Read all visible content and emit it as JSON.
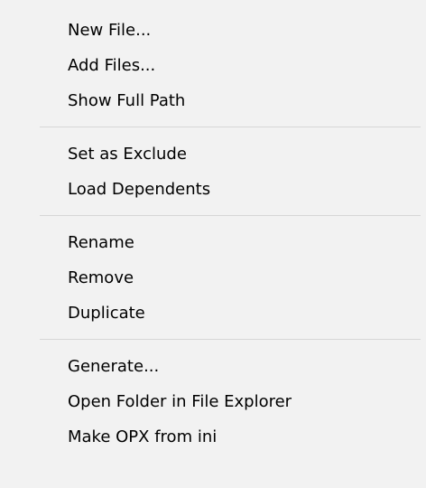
{
  "menu": {
    "groups": [
      {
        "items": [
          {
            "label": "New File..."
          },
          {
            "label": "Add Files..."
          },
          {
            "label": "Show Full Path"
          }
        ]
      },
      {
        "items": [
          {
            "label": "Set as Exclude"
          },
          {
            "label": "Load Dependents"
          }
        ]
      },
      {
        "items": [
          {
            "label": "Rename"
          },
          {
            "label": "Remove"
          },
          {
            "label": "Duplicate"
          }
        ]
      },
      {
        "items": [
          {
            "label": "Generate..."
          },
          {
            "label": "Open Folder in File Explorer"
          },
          {
            "label": "Make OPX from ini"
          }
        ]
      }
    ]
  },
  "colors": {
    "background": "#f2f2f2",
    "separator": "#d7d7d7",
    "text": "#000000"
  }
}
